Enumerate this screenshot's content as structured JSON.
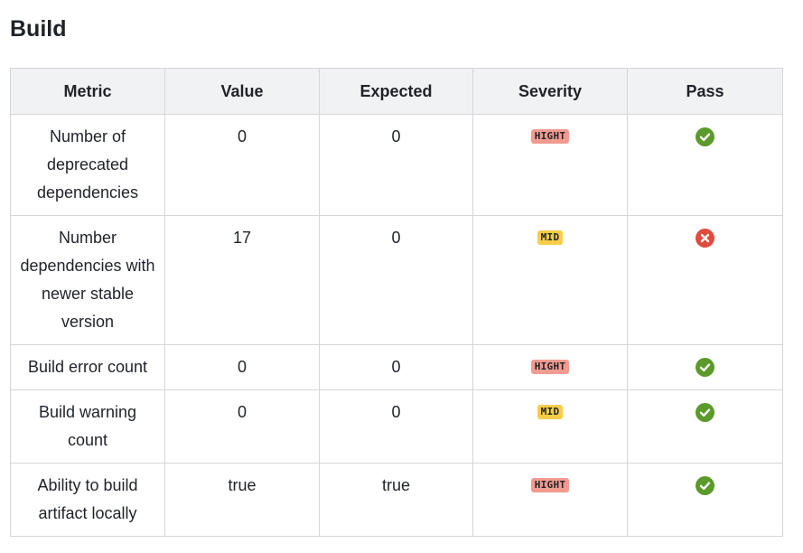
{
  "section": {
    "title": "Build"
  },
  "table": {
    "headers": [
      "Metric",
      "Value",
      "Expected",
      "Severity",
      "Pass"
    ],
    "rows": [
      {
        "metric": "Number of deprecated dependencies",
        "value": "0",
        "expected": "0",
        "severity": "HIGHT",
        "pass": "check-icon"
      },
      {
        "metric": "Number dependencies with newer stable version",
        "value": "17",
        "expected": "0",
        "severity": "MID",
        "pass": "cross-icon"
      },
      {
        "metric": "Build error count",
        "value": "0",
        "expected": "0",
        "severity": "HIGHT",
        "pass": "check-icon"
      },
      {
        "metric": "Build warning count",
        "value": "0",
        "expected": "0",
        "severity": "MID",
        "pass": "check-icon"
      },
      {
        "metric": "Ability to build artifact locally",
        "value": "true",
        "expected": "true",
        "severity": "HIGHT",
        "pass": "check-icon"
      }
    ]
  },
  "colors": {
    "header_bg": "#f1f2f3",
    "border": "#d4d6d9",
    "severity_high": "#f29b91",
    "severity_mid": "#f6cd48",
    "pass_green": "#5b9a2b",
    "fail_red": "#e04b3f"
  }
}
